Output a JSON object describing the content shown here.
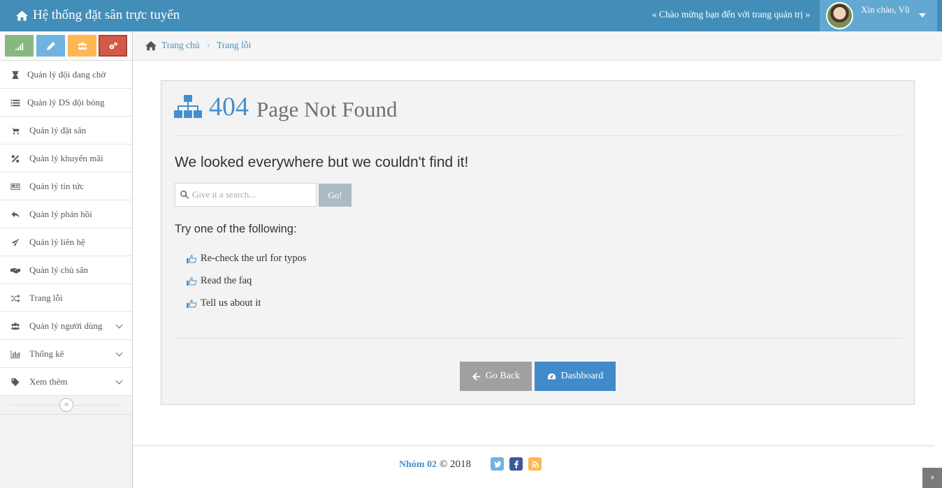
{
  "navbar": {
    "brand": "Hệ thống đặt sân trực tuyến",
    "welcome": "« Chào mừng bạn đến với trang quản trị »",
    "user_greeting": "Xin chào, Vũ",
    "bg_color": "#438eb9"
  },
  "shortcuts": [
    {
      "icon": "signal-icon",
      "color": "#87b87f"
    },
    {
      "icon": "pencil-icon",
      "color": "#6fb3e0"
    },
    {
      "icon": "users-icon",
      "color": "#ffb752"
    },
    {
      "icon": "cogs-icon",
      "color": "#d15b47"
    }
  ],
  "sidebar": {
    "items": [
      {
        "label": "Quản lý đội đang chờ",
        "icon": "hourglass-icon"
      },
      {
        "label": "Quản lý DS đội bóng",
        "icon": "list-icon"
      },
      {
        "label": "Quản lý đặt sân",
        "icon": "cart-icon"
      },
      {
        "label": "Quản lý khuyến mãi",
        "icon": "percent-icon"
      },
      {
        "label": "Quản lý tin tức",
        "icon": "newspaper-icon"
      },
      {
        "label": "Quản lý phản hồi",
        "icon": "reply-icon"
      },
      {
        "label": "Quản lý liên hệ",
        "icon": "paper-plane-icon"
      },
      {
        "label": "Quản lý chủ sân",
        "icon": "handshake-icon"
      },
      {
        "label": "Trang lỗi",
        "icon": "random-icon"
      },
      {
        "label": "Quản lý người dùng",
        "icon": "users-icon",
        "has_submenu": true
      },
      {
        "label": "Thống kê",
        "icon": "bar-chart-icon",
        "has_submenu": true
      },
      {
        "label": "Xem thêm",
        "icon": "tag-icon",
        "has_submenu": true
      }
    ],
    "collapse_glyph": "«"
  },
  "breadcrumbs": {
    "home": "Trang chủ",
    "current": "Trang lỗi",
    "separator": "›"
  },
  "error": {
    "code": "404",
    "title": "Page Not Found",
    "message": "We looked everywhere but we couldn't find it!",
    "search_placeholder": "Give it a search...",
    "search_button": "Go!",
    "try_heading": "Try one of the following:",
    "suggestions": [
      "Re-check the url for typos",
      "Read the faq",
      "Tell us about it"
    ],
    "back_button": "Go Back",
    "dashboard_button": "Dashboard"
  },
  "footer": {
    "team": "Nhóm 02",
    "copyright": "© 2018",
    "social": [
      "twitter-icon",
      "facebook-icon",
      "rss-icon"
    ]
  },
  "scroll_top_glyph": "»"
}
